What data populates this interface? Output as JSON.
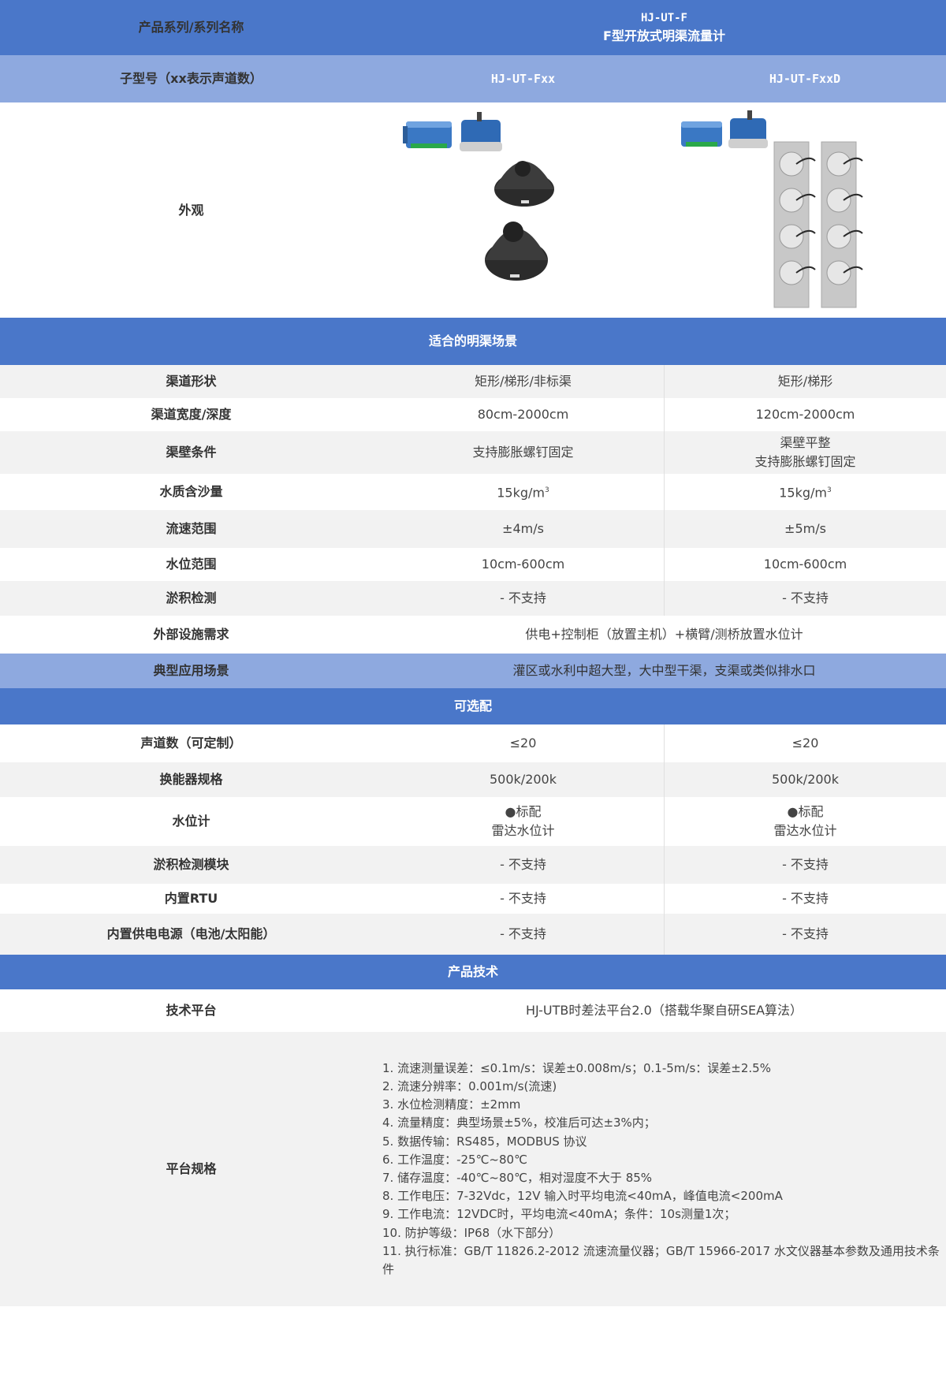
{
  "header": {
    "row_label": "产品系列/系列名称",
    "series_code": "HJ-UT-F",
    "series_name": "F型开放式明渠流量计"
  },
  "subtype": {
    "row_label": "子型号（xx表示声道数）",
    "models": [
      "HJ-UT-Fxx",
      "HJ-UT-FxxD"
    ]
  },
  "appearance": {
    "row_label": "外观"
  },
  "sections": {
    "scenarios": "适合的明渠场景",
    "options": "可选配",
    "tech": "产品技术"
  },
  "scenario_rows": [
    {
      "label": "渠道形状",
      "values": [
        "矩形/梯形/非标渠",
        "矩形/梯形"
      ]
    },
    {
      "label": "渠道宽度/深度",
      "values": [
        "80cm-2000cm",
        "120cm-2000cm"
      ]
    },
    {
      "label": "渠壁条件",
      "values": [
        "支持膨胀螺钉固定",
        "渠壁平整"
      ],
      "extra": "支持膨胀螺钉固定"
    },
    {
      "label": "水质含沙量",
      "values": [
        "15kg/m",
        "15kg/m"
      ],
      "sup": "3"
    },
    {
      "label": "流速范围",
      "values": [
        "±4m/s",
        "±5m/s"
      ]
    },
    {
      "label": "水位范围",
      "values": [
        "10cm-600cm",
        "10cm-600cm"
      ]
    },
    {
      "label": "淤积检测",
      "values": [
        "- 不支持",
        "- 不支持"
      ]
    }
  ],
  "external": {
    "label": "外部设施需求",
    "value": "供电+控制柜（放置主机）+横臂/测桥放置水位计"
  },
  "typical": {
    "label": "典型应用场景",
    "value": "灌区或水利中超大型，大中型干渠，支渠或类似排水口"
  },
  "option_rows": [
    {
      "label": "声道数（可定制）",
      "values": [
        "≤20",
        "≤20"
      ]
    },
    {
      "label": "换能器规格",
      "values": [
        "500k/200k",
        "500k/200k"
      ]
    },
    {
      "label": "水位计",
      "values": [
        "●标配",
        "●标配"
      ],
      "extra": "雷达水位计"
    },
    {
      "label": "淤积检测模块",
      "values": [
        "- 不支持",
        "- 不支持"
      ]
    },
    {
      "label": "内置RTU",
      "values": [
        "- 不支持",
        "- 不支持"
      ]
    },
    {
      "label": "内置供电电源（电池/太阳能）",
      "values": [
        "- 不支持",
        "- 不支持"
      ]
    }
  ],
  "tech_platform": {
    "label": "技术平台",
    "value": "HJ-UTB时差法平台2.0（搭载华聚自研SEA算法）"
  },
  "platform_spec": {
    "label": "平台规格",
    "items": [
      "1. 流速测量误差：≤0.1m/s：误差±0.008m/s；0.1-5m/s：误差±2.5%",
      "2. 流速分辨率：0.001m/s(流速)",
      "3. 水位检测精度：±2mm",
      "4. 流量精度：典型场景±5%，校准后可达±3%内；",
      "5. 数据传输：RS485，MODBUS 协议",
      "6. 工作温度：-25℃~80℃",
      "7. 储存温度：-40℃~80℃，相对湿度不大于 85%",
      "8. 工作电压：7-32Vdc，12V 输入时平均电流<40mA，峰值电流<200mA",
      "9. 工作电流：12VDC时，平均电流<40mA；条件：10s测量1次；",
      "10. 防护等级：IP68（水下部分）",
      "11. 执行标准：GB/T 11826.2-2012 流速流量仪器；GB/T 15966-2017 水文仪器基本参数及通用技术条件"
    ]
  },
  "colors": {
    "header_blue": "#4a77c9",
    "light_blue": "#8ea9df",
    "row_gray": "#f2f2f2"
  },
  "icons": [
    "host-box-icon",
    "controller-box-icon",
    "dome-sensor-icon",
    "transducer-bracket-icon"
  ]
}
